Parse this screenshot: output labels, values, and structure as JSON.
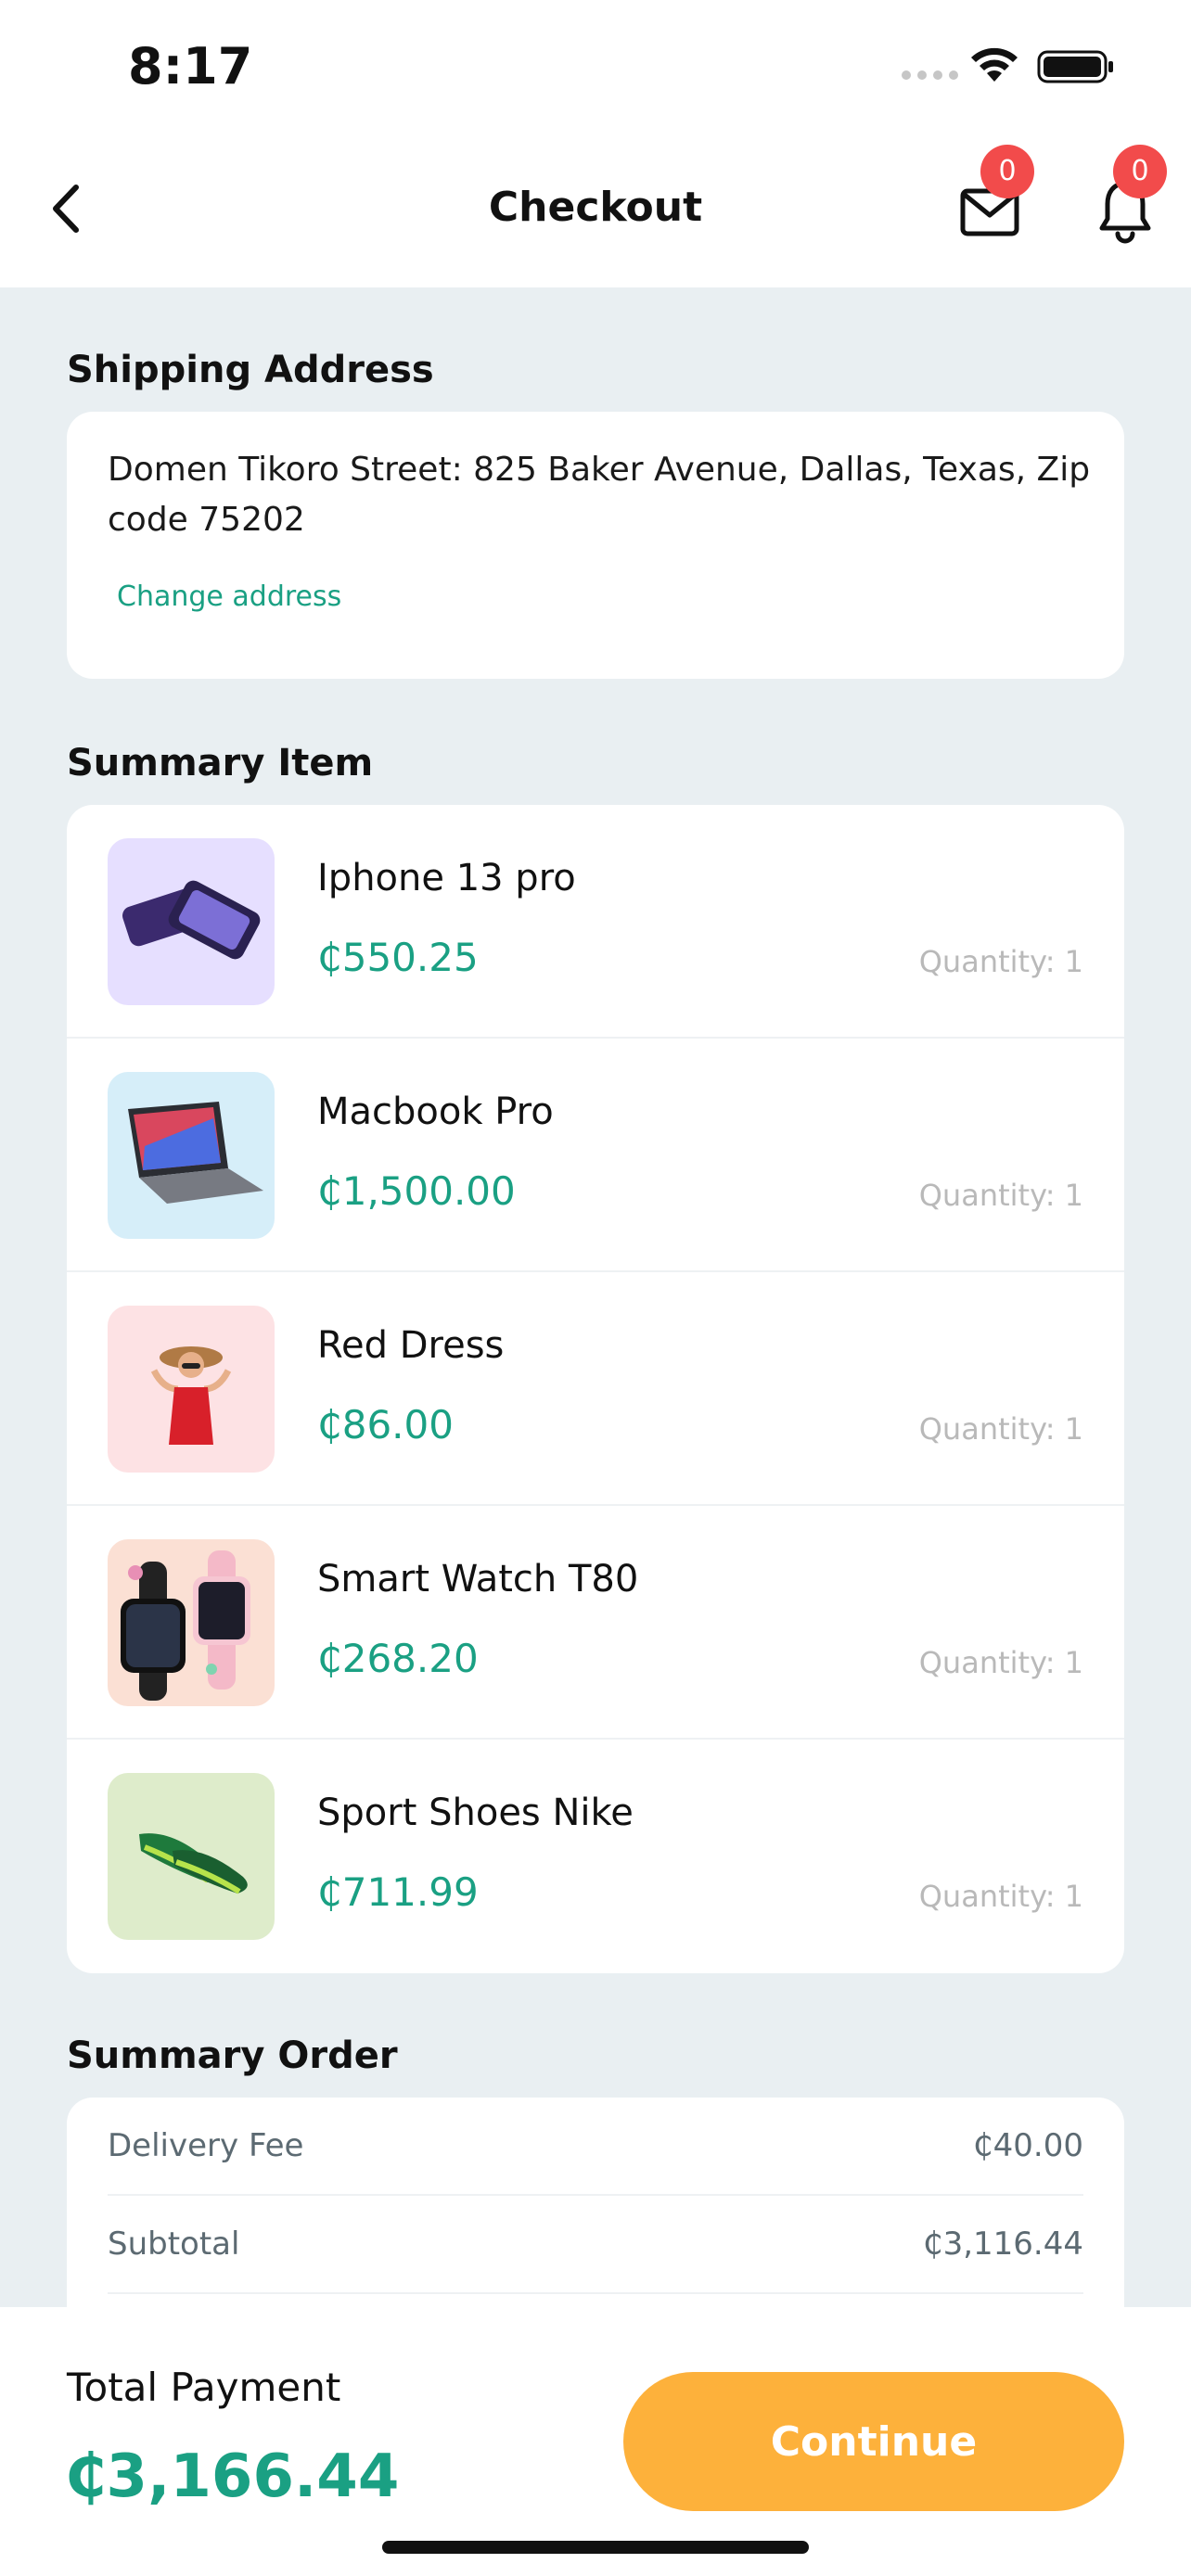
{
  "status_bar": {
    "time": "8:17"
  },
  "header": {
    "title": "Checkout",
    "mail_badge": "0",
    "notification_badge": "0",
    "back_icon": "chevron-left-icon",
    "mail_icon": "mail-icon",
    "bell_icon": "bell-icon"
  },
  "shipping": {
    "title": "Shipping Address",
    "address": "Domen Tikoro Street: 825 Baker Avenue, Dallas, Texas, Zip code 75202",
    "change_label": "Change address"
  },
  "summary_item": {
    "title": "Summary Item",
    "items": [
      {
        "name": "Iphone 13 pro",
        "price": "₵550.25",
        "quantity": "Quantity: 1",
        "thumb_color": "#e6dfff"
      },
      {
        "name": "Macbook Pro",
        "price": "₵1,500.00",
        "quantity": "Quantity: 1",
        "thumb_color": "#d6eef9"
      },
      {
        "name": "Red Dress",
        "price": "₵86.00",
        "quantity": "Quantity: 1",
        "thumb_color": "#fde2e4"
      },
      {
        "name": "Smart Watch T80",
        "price": "₵268.20",
        "quantity": "Quantity: 1",
        "thumb_color": "#fbe0d4"
      },
      {
        "name": "Sport Shoes Nike",
        "price": "₵711.99",
        "quantity": "Quantity: 1",
        "thumb_color": "#deeccb"
      }
    ]
  },
  "summary_order": {
    "title": "Summary Order",
    "rows": [
      {
        "label": "Delivery Fee",
        "value": "₵40.00"
      },
      {
        "label": "Subtotal",
        "value": "₵3,116.44"
      }
    ]
  },
  "footer": {
    "total_label": "Total Payment",
    "total_value": "₵3,166.44",
    "continue_label": "Continue"
  },
  "colors": {
    "accent": "#1aa083",
    "button": "#fdb13b",
    "badge": "#f24b4b",
    "background": "#e9eff2"
  }
}
